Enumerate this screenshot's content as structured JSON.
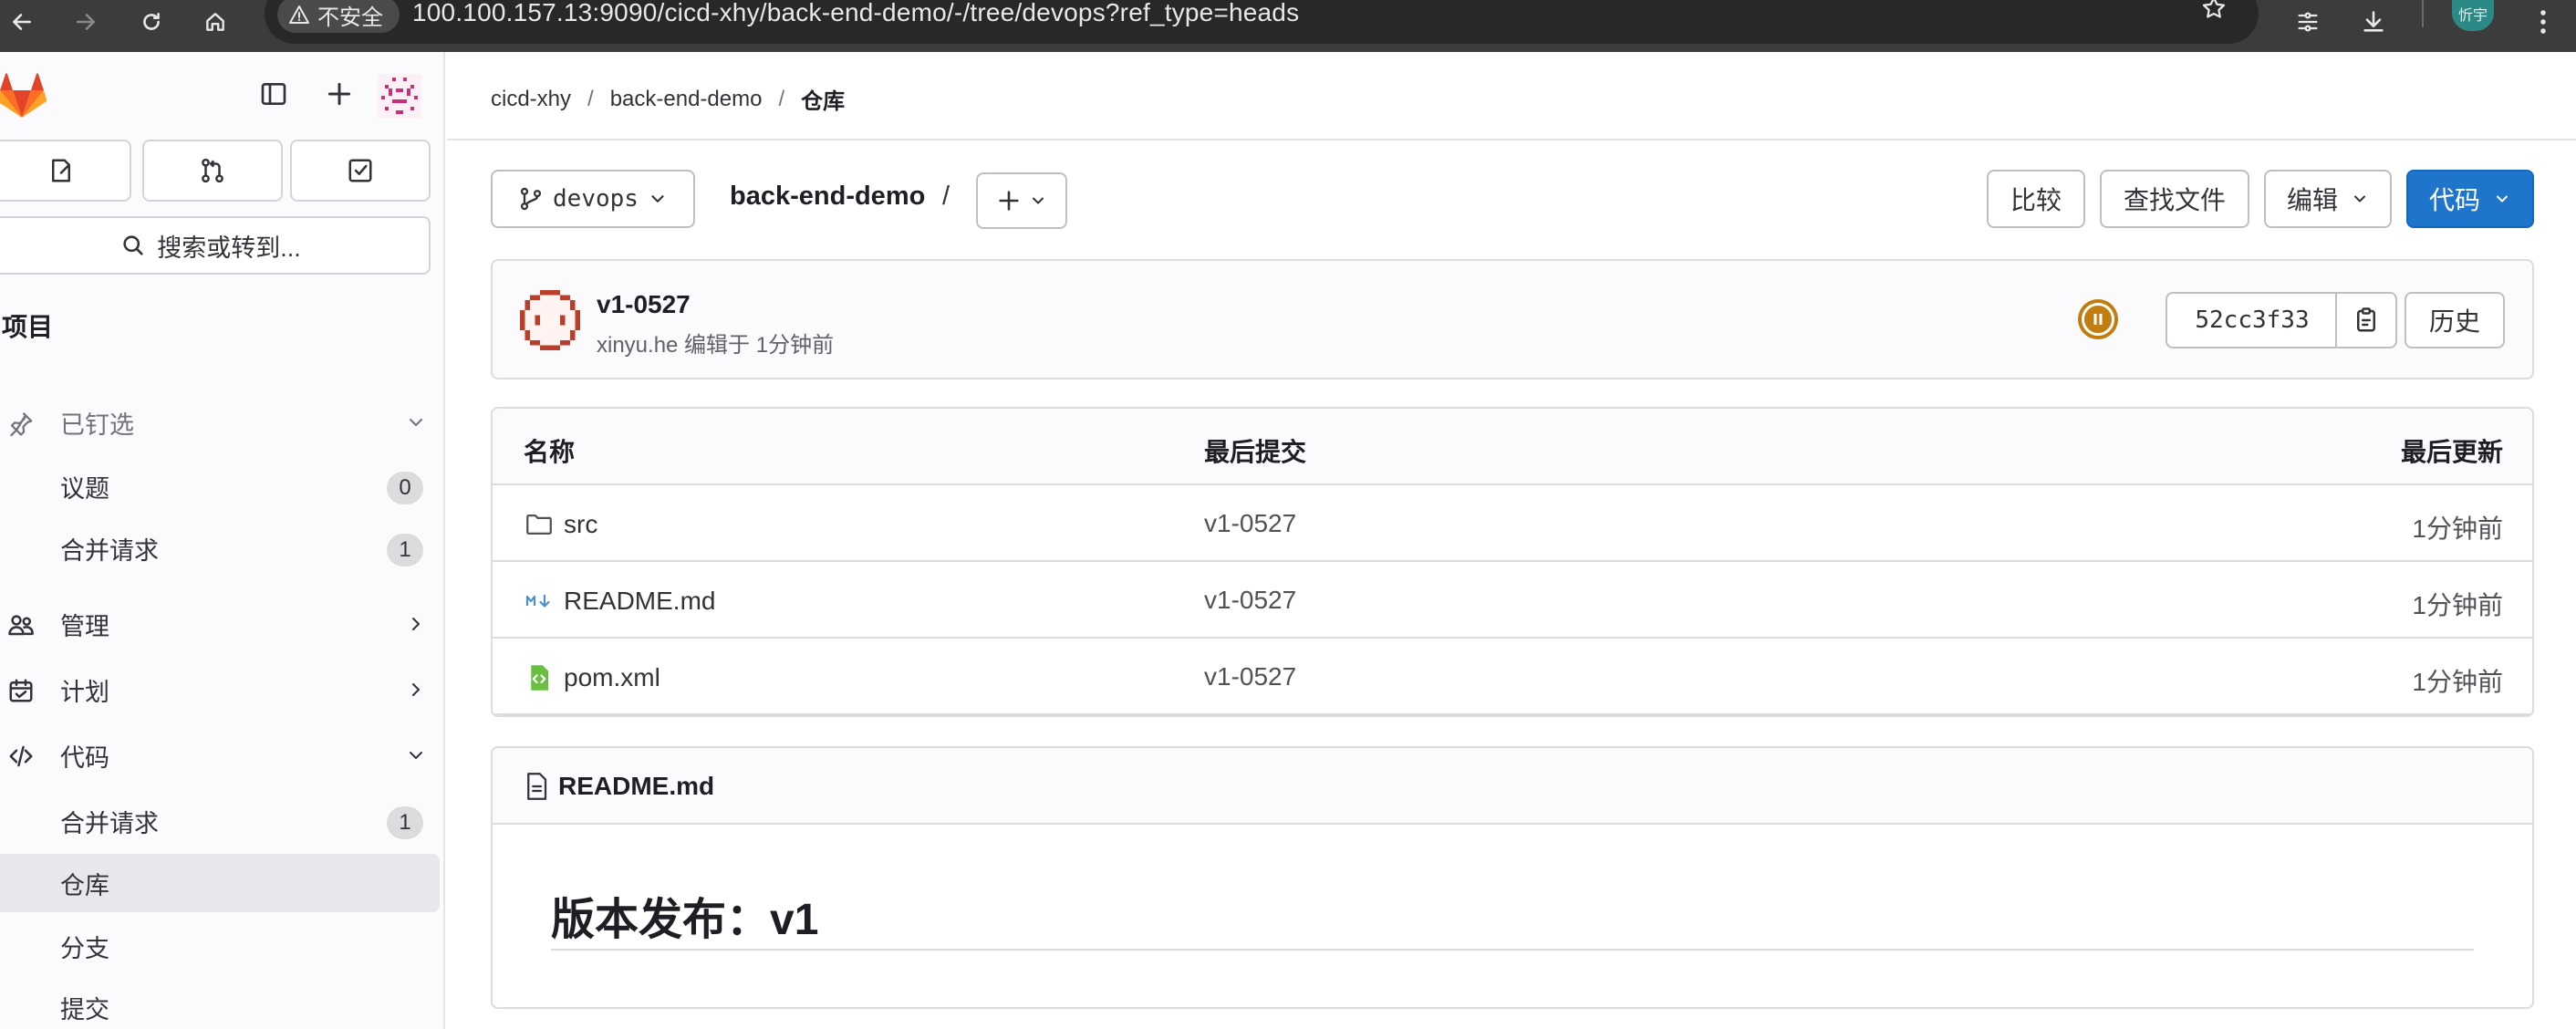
{
  "browser": {
    "security_label": "不安全",
    "url": "100.100.157.13:9090/cicd-xhy/back-end-demo/-/tree/devops?ref_type=heads",
    "profile_label": "忻宇"
  },
  "sidebar": {
    "search_label": "搜索或转到...",
    "context_heading": "项目",
    "items": [
      {
        "label": "已钉选"
      },
      {
        "label": "议题",
        "count": "0"
      },
      {
        "label": "合并请求",
        "count": "1"
      },
      {
        "label": "管理"
      },
      {
        "label": "计划"
      },
      {
        "label": "代码"
      },
      {
        "label": "合并请求",
        "count": "1"
      },
      {
        "label": "仓库"
      },
      {
        "label": "分支"
      },
      {
        "label": "提交"
      }
    ]
  },
  "breadcrumb": [
    "cicd-xhy",
    "back-end-demo",
    "仓库"
  ],
  "toolbar": {
    "branch": "devops",
    "repo_name": "back-end-demo",
    "path_sep": "/",
    "compare": "比较",
    "find_file": "查找文件",
    "edit": "编辑",
    "code": "代码"
  },
  "commit": {
    "title": "v1-0527",
    "meta": "xinyu.he 编辑于 1分钟前",
    "sha": "52cc3f33",
    "history": "历史"
  },
  "files": {
    "headers": [
      "名称",
      "最后提交",
      "最后更新"
    ],
    "rows": [
      {
        "name": "src",
        "commit": "v1-0527",
        "updated": "1分钟前",
        "icon": "folder-icon"
      },
      {
        "name": "README.md",
        "commit": "v1-0527",
        "updated": "1分钟前",
        "icon": "markdown-icon"
      },
      {
        "name": "pom.xml",
        "commit": "v1-0527",
        "updated": "1分钟前",
        "icon": "xml-file-icon"
      }
    ]
  },
  "readme": {
    "filename": "README.md",
    "heading": "版本发布：v1"
  },
  "colors": {
    "primary": "#1f75cb",
    "pipeline_paused": "#c17d10",
    "sidebar_bg": "#fbfafd"
  }
}
